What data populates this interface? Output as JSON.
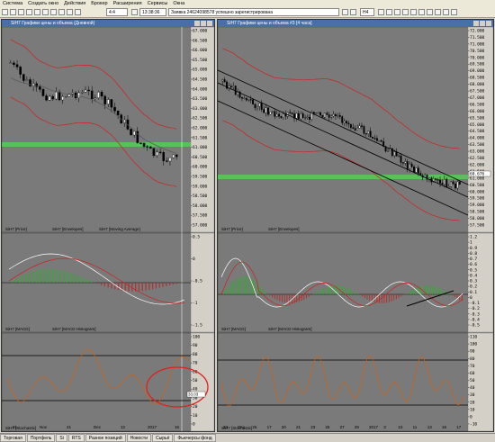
{
  "menu": [
    "Система",
    "Создать окно",
    "Действия",
    "Брокер",
    "Расширения",
    "Сервисы",
    "Окна"
  ],
  "toolbar": {
    "field1": "4:4",
    "time_field": "13:38:36",
    "status_text": "Заявка 24624098578 успешно зарегистрирована",
    "interval": "H4"
  },
  "windows": {
    "left": {
      "title": "SiH7 Графики цены и объема",
      "title_suffix": "(Дневной)",
      "price_legend": [
        "SiH7 [Price]",
        "SiH7 [Envelopes]",
        "SiH7 [Moving Average]"
      ],
      "macd_legend": [
        "SiH7 [MACD]",
        "SiH7 [MACD Histogram]"
      ],
      "stoch_legend": [
        "SiH7 [Stochastic]"
      ],
      "x_ticks": [
        "21",
        "Nov",
        "21",
        "Dec",
        "12",
        "2017",
        "16"
      ],
      "stoch_value": "33.03"
    },
    "right": {
      "title": "SiH7 Графики цены и объема #3",
      "title_suffix": "[4 часа]",
      "price_legend": [
        "SiH7 [Price]",
        "SiH7 [Envelopes]"
      ],
      "macd_legend": [
        "SiH7 [MACD]",
        "SiH7 [MACD Histogram]"
      ],
      "stoch_legend": [
        "SiH7 [Stochastic]"
      ],
      "x_ticks": [
        "23",
        "Dec",
        "25",
        "17",
        "20",
        "21",
        "23",
        "25",
        "27",
        "29",
        "2017",
        "3",
        "10",
        "11",
        "13",
        "16",
        "17"
      ],
      "last_price": "60.676"
    }
  },
  "axes": {
    "left_price": [
      "67.000",
      "66.500",
      "66.000",
      "65.500",
      "65.000",
      "64.500",
      "64.000",
      "63.500",
      "63.000",
      "62.500",
      "62.000",
      "61.500",
      "61.000",
      "60.500",
      "60.000",
      "59.500",
      "59.000",
      "58.500",
      "58.000",
      "57.500",
      "57.000"
    ],
    "right_price": [
      "72.000",
      "71.500",
      "71.000",
      "70.500",
      "70.000",
      "69.500",
      "69.000",
      "68.500",
      "68.000",
      "67.500",
      "67.000",
      "66.500",
      "66.000",
      "65.500",
      "65.000",
      "64.500",
      "64.000",
      "63.500",
      "63.000",
      "62.500",
      "62.000",
      "61.500",
      "61.000",
      "60.500",
      "60.000",
      "59.500",
      "59.000",
      "58.500",
      "58.000",
      "57.500"
    ],
    "left_macd": [
      "0.5",
      "0",
      "-0.5",
      "-1",
      "-1.5"
    ],
    "right_macd": [
      "1.2",
      "1",
      "0.9",
      "0.8",
      "0.7",
      "0.6",
      "0.5",
      "0.4",
      "0.3",
      "0.2",
      "0.1",
      "0",
      "-0.1",
      "-0.2",
      "-0.3",
      "-0.4",
      "-0.5"
    ],
    "left_stoch": [
      "100",
      "90",
      "80",
      "70",
      "60",
      "50",
      "40",
      "30",
      "20",
      "10",
      "0"
    ],
    "right_stoch": [
      "110",
      "100",
      "90",
      "80",
      "70",
      "60",
      "50",
      "40",
      "30",
      "20",
      "10",
      "0",
      "-10"
    ]
  },
  "taskbar": [
    "Торговая",
    "Портфель",
    "Si",
    "RTS",
    "Разное позиций",
    "Новости",
    "Сырьё",
    "Фьючерсы фонд"
  ],
  "colors": {
    "background": "#777777",
    "candle": "#000000",
    "envelope": "#d02020",
    "support": "#58c858",
    "macd_line": "#ffffff",
    "stoch": "#d06010",
    "circle": "#e02020"
  }
}
